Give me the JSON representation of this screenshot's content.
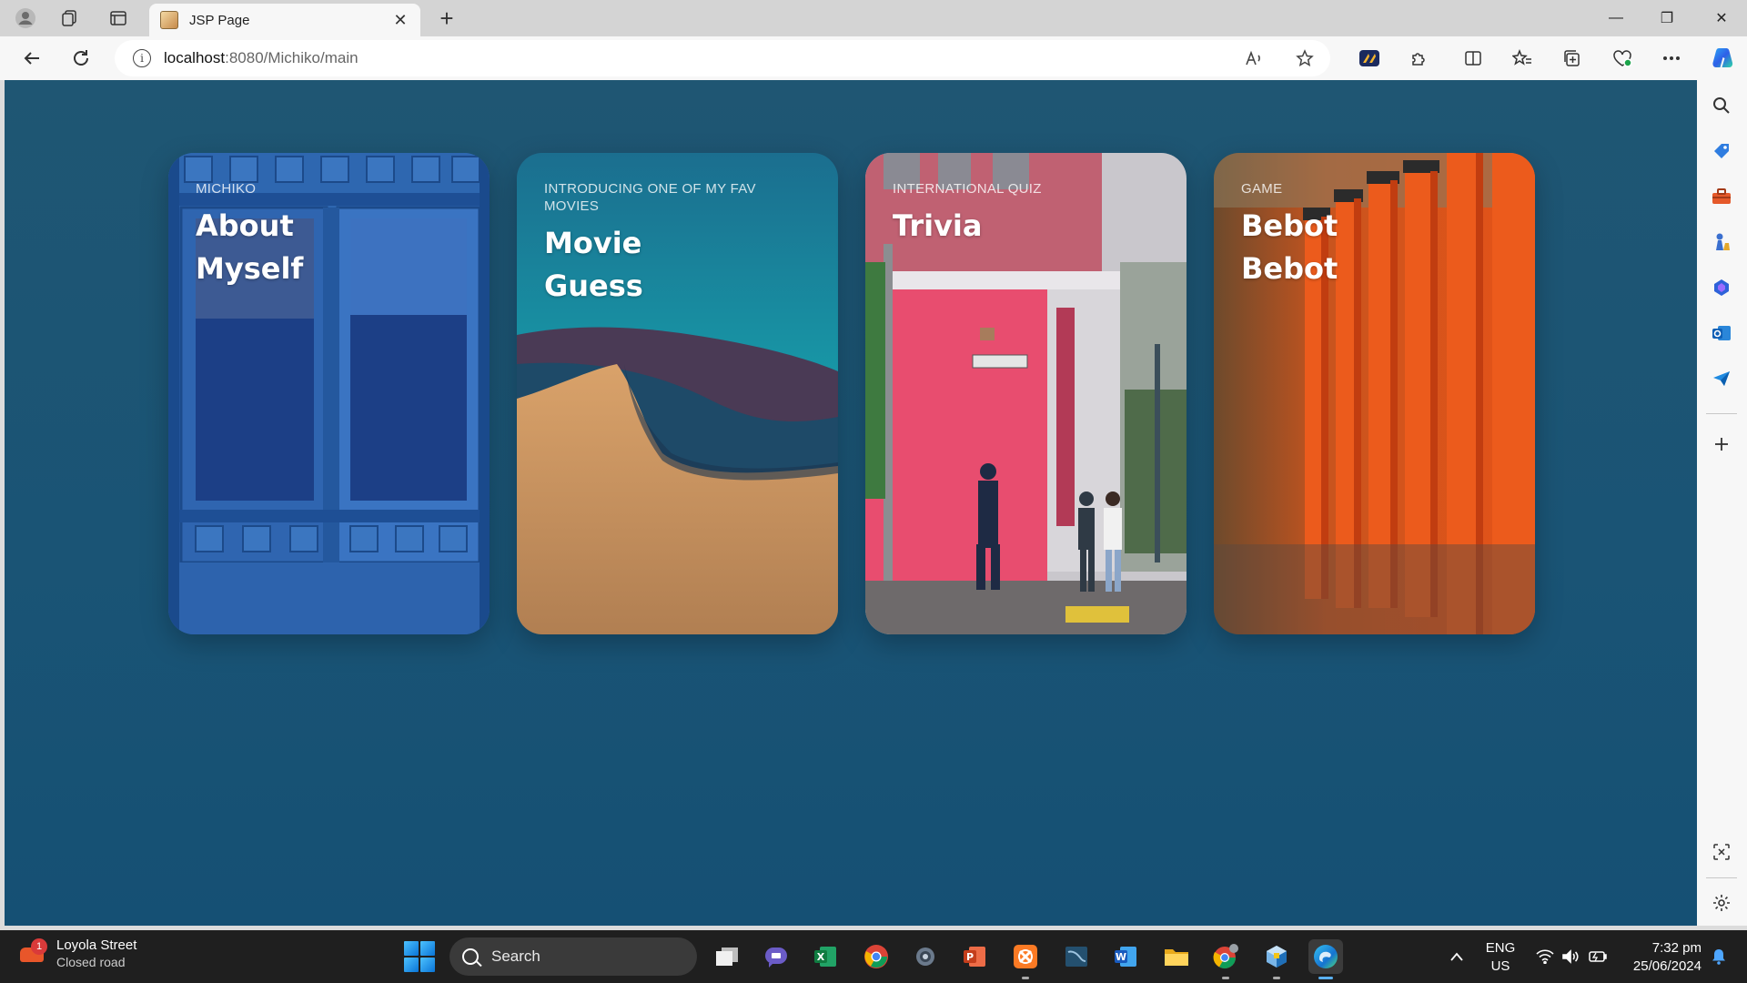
{
  "browser": {
    "tab_title": "JSP Page",
    "tab_close": "✕",
    "new_tab": "+",
    "url_host": "localhost",
    "url_rest": ":8080/Michiko/main",
    "window_controls": {
      "minimize": "—",
      "restore": "❐",
      "close": "✕"
    }
  },
  "cards": [
    {
      "kicker": "MICHIKO",
      "title": "About\nMyself"
    },
    {
      "kicker": "INTRODUCING ONE OF MY FAV MOVIES",
      "title": "Movie\nGuess"
    },
    {
      "kicker": "INTERNATIONAL QUIZ",
      "title": "Trivia"
    },
    {
      "kicker": "GAME",
      "title": "Bebot\nBebot"
    }
  ],
  "sidebar_icons": [
    "search-icon",
    "tag-icon",
    "toolbox-icon",
    "chess-icon",
    "copilot-icon",
    "outlook-icon",
    "send-icon",
    "add-icon",
    "screenshot-icon",
    "settings-icon"
  ],
  "taskbar": {
    "weather_badge": "1",
    "weather_line1": "Loyola Street",
    "weather_line2": "Closed road",
    "search_label": "Search",
    "lang_line1": "ENG",
    "lang_line2": "US",
    "time": "7:32 pm",
    "date": "25/06/2024"
  },
  "colors": {
    "page_bg": "#1a5475",
    "excel": "#107c41",
    "powerpoint": "#c43e1c",
    "word": "#185abd"
  }
}
